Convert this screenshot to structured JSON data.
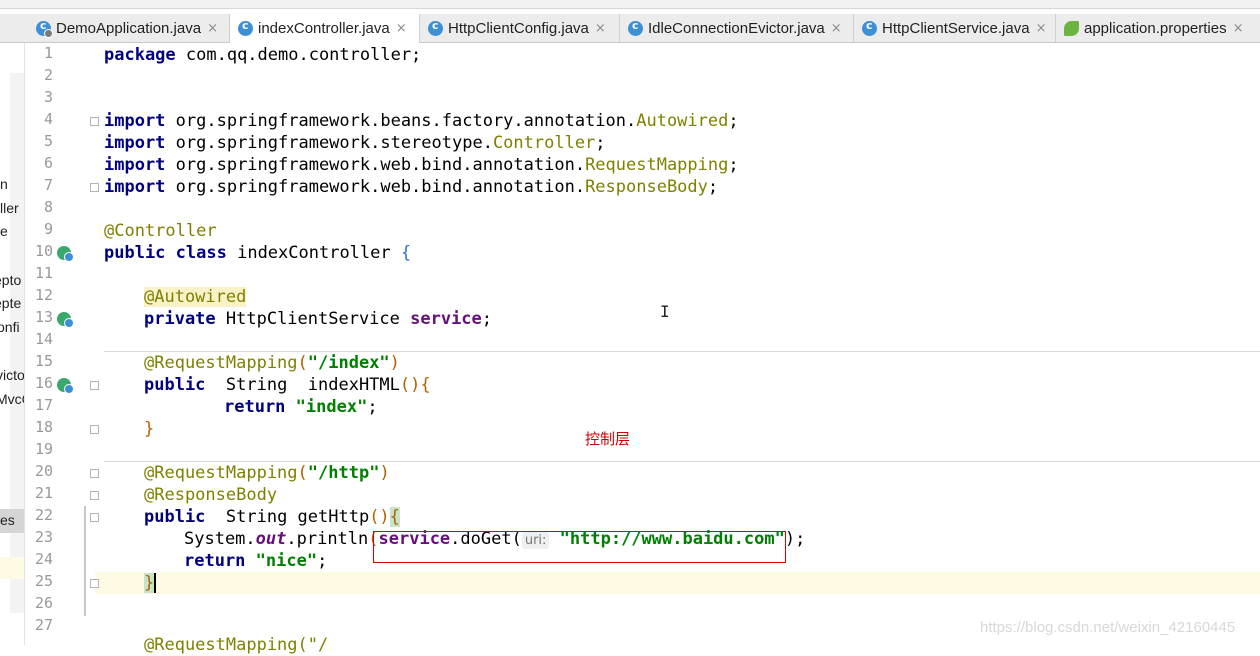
{
  "tabs": [
    {
      "label": "DemoApplication.java",
      "icon": "spring-class-icon",
      "active": false
    },
    {
      "label": "indexController.java",
      "icon": "class-icon",
      "active": true
    },
    {
      "label": "HttpClientConfig.java",
      "icon": "class-icon",
      "active": false
    },
    {
      "label": "IdleConnectionEvictor.java",
      "icon": "class-icon",
      "active": false
    },
    {
      "label": "HttpClientService.java",
      "icon": "class-icon",
      "active": false
    },
    {
      "label": "application.properties",
      "icon": "spring-leaf-icon",
      "active": false
    }
  ],
  "tab_close_glyph": "×",
  "project_panel_fragments": [
    "n",
    "ller",
    "e",
    "epto",
    "epte",
    "onfi",
    "victo",
    "MvcC",
    "es"
  ],
  "line_numbers": [
    "1",
    "2",
    "3",
    "4",
    "5",
    "6",
    "7",
    "8",
    "9",
    "10",
    "11",
    "12",
    "13",
    "14",
    "15",
    "16",
    "17",
    "18",
    "19",
    "20",
    "21",
    "22",
    "23",
    "24",
    "25",
    "26",
    "27"
  ],
  "code": {
    "l1_kw": "package",
    "l1_rest": " com.qq.demo.controller;",
    "import_kw": "import",
    "l4_pkg": " org.springframework.beans.factory.annotation.",
    "l4_cls": "Autowired",
    "l5_pkg": " org.springframework.stereotype.",
    "l5_cls": "Controller",
    "l6_pkg": " org.springframework.web.bind.annotation.",
    "l6_cls": "RequestMapping",
    "l7_pkg": " org.springframework.web.bind.annotation.",
    "l7_cls": "ResponseBody",
    "semi": ";",
    "l9_ann": "@Controller",
    "public_kw": "public",
    "class_kw": "class",
    "l10_name": " indexController ",
    "open_brace": "{",
    "l12_ann": "@Autowired",
    "private_kw": "private",
    "l13_type": " HttpClientService ",
    "l13_field": "service",
    "l15_ann": "@RequestMapping",
    "l15_arg": "\"/index\"",
    "l16_rest": "  String  indexHTML",
    "parens": "()",
    "return_kw": "return",
    "l17_str": "\"index\"",
    "close_brace": "}",
    "l20_arg": "\"/http\"",
    "l21_ann": "@ResponseBody",
    "l22_rest": "  String getHttp",
    "l23_sys": "System.",
    "l23_out": "out",
    "l23_println": ".println",
    "l23_service": "service",
    "l23_doget": ".doGet(",
    "l23_hint": "uri:",
    "l23_str": "\"http://www.baidu.com\"",
    "l23_end": ");",
    "l24_str": "\"nice\"",
    "l28_partial": "@RequestMapping(\"/"
  },
  "annotation_note": "控制层",
  "watermark": "https://blog.csdn.net/weixin_42160445",
  "colors": {
    "keyword": "#000080",
    "annotation": "#808000",
    "string": "#008000",
    "field": "#660e7a",
    "note": "#d00000"
  }
}
